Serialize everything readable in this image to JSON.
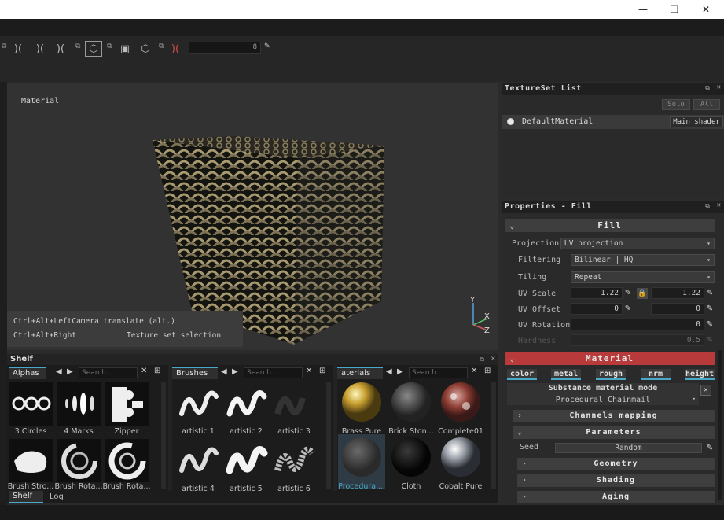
{
  "window": {
    "minimize_glyph": "—",
    "maximize_glyph": "❐",
    "close_glyph": "✕"
  },
  "toolbar": {
    "field_value": "8"
  },
  "viewport": {
    "label": "Material",
    "hint_line1": "Ctrl+Alt+LeftCamera translate (alt.)",
    "hint_line2_key": "Ctrl+Alt+Right",
    "hint_line2_action": "Texture set selection",
    "gizmo": {
      "y": "Y",
      "x": "X",
      "z": "Z"
    }
  },
  "textureset": {
    "title": "TextureSet List",
    "solo_label": "Solo",
    "all_label": "All",
    "item_name": "DefaultMaterial",
    "item_shader": "Main shader"
  },
  "properties": {
    "title": "Properties - Fill",
    "fill_header": "Fill",
    "projection_label": "Projection",
    "projection_value": "UV projection",
    "filtering_label": "Filtering",
    "filtering_value": "Bilinear | HQ",
    "tiling_label": "Tiling",
    "tiling_value": "Repeat",
    "uvscale_label": "UV Scale",
    "uvscale_a": "1.22",
    "uvscale_b": "1.22",
    "uvoffset_label": "UV Offset",
    "uvoffset_a": "0",
    "uvoffset_b": "0",
    "uvrotation_label": "UV Rotation",
    "uvrotation_value": "0",
    "hardness_label": "Hardness",
    "hardness_value": "0.5",
    "material_header": "Material",
    "channels": [
      "color",
      "metal",
      "rough",
      "nrm",
      "height"
    ],
    "substance_mode": "Substance material mode",
    "substance_name": "Procedural Chainmail",
    "channels_mapping": "Channels mapping",
    "parameters": "Parameters",
    "seed_label": "Seed",
    "seed_value": "Random",
    "geometry": "Geometry",
    "shading": "Shading",
    "aging": "Aging"
  },
  "shelf": {
    "title": "Shelf",
    "search_placeholder": "Search...",
    "alphas_tab": "Alphas",
    "brushes_tab": "Brushes",
    "materials_tab": "aterials",
    "alphas": [
      "3 Circles",
      "4 Marks",
      "Zipper",
      "Brush Stro...",
      "Brush Rota...",
      "Brush Rota..."
    ],
    "brushes": [
      "artistic 1",
      "artistic 2",
      "artistic 3",
      "artistic 4",
      "artistic 5",
      "artistic 6"
    ],
    "materials": [
      "Brass Pure",
      "Brick Ston...",
      "Complete01",
      "Procedural...",
      "Cloth",
      "Cobalt Pure"
    ],
    "bottom_tab_shelf": "Shelf",
    "bottom_tab_log": "Log"
  },
  "colors": {
    "accent": "#4aa8c8",
    "material_header": "#b83a3a",
    "background": "#2b2b2b"
  }
}
